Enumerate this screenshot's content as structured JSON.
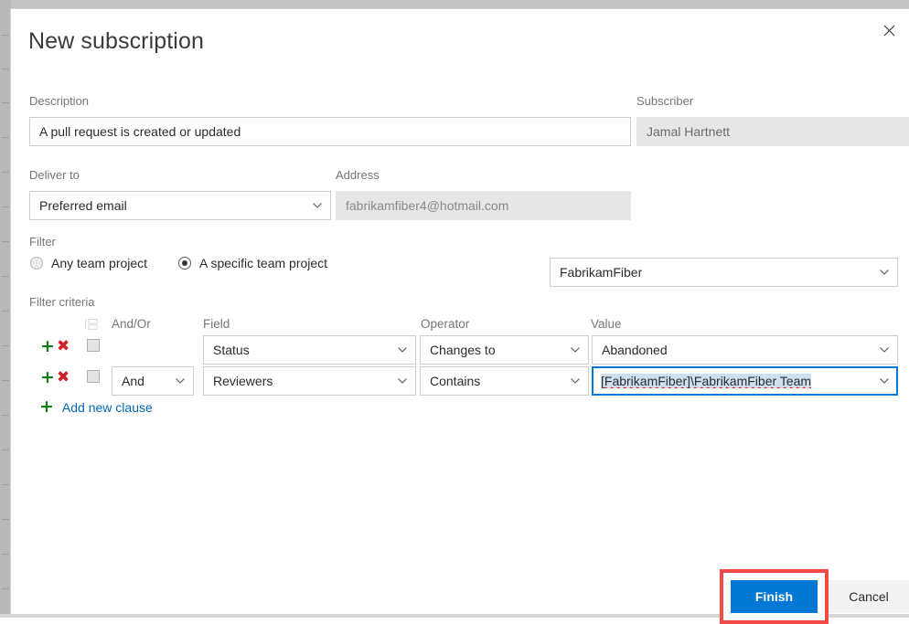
{
  "dialog": {
    "title": "New subscription",
    "close_icon": "close-icon"
  },
  "description": {
    "label": "Description",
    "value": "A pull request is created or updated"
  },
  "subscriber": {
    "label": "Subscriber",
    "value": "Jamal Hartnett"
  },
  "deliver_to": {
    "label": "Deliver to",
    "value": "Preferred email",
    "chevron_icon": "chevron-down-icon"
  },
  "address": {
    "label": "Address",
    "value": "fabrikamfiber4@hotmail.com"
  },
  "filter": {
    "label": "Filter",
    "options": [
      {
        "label": "Any team project",
        "selected": false
      },
      {
        "label": "A specific team project",
        "selected": true
      }
    ],
    "project": {
      "value": "FabrikamFiber",
      "chevron_icon": "chevron-down-icon"
    }
  },
  "filter_criteria": {
    "label": "Filter criteria",
    "grid_icon": "list-grid-icon",
    "columns": {
      "and_or": "And/Or",
      "field": "Field",
      "operator": "Operator",
      "value": "Value"
    },
    "rows": [
      {
        "add_icon": "plus-icon",
        "delete_icon": "remove-icon",
        "checked": false,
        "and_or": "",
        "field": "Status",
        "operator": "Changes to",
        "value": "Abandoned",
        "value_focused": false
      },
      {
        "add_icon": "plus-icon",
        "delete_icon": "remove-icon",
        "checked": false,
        "and_or": "And",
        "field": "Reviewers",
        "operator": "Contains",
        "value": "[FabrikamFiber]\\FabrikamFiber Team",
        "value_focused": true
      }
    ],
    "add_clause": {
      "icon": "plus-icon",
      "label": "Add new clause"
    }
  },
  "footer": {
    "finish_label": "Finish",
    "cancel_label": "Cancel",
    "highlight_color": "#f14a47",
    "primary_color": "#0078d4"
  }
}
